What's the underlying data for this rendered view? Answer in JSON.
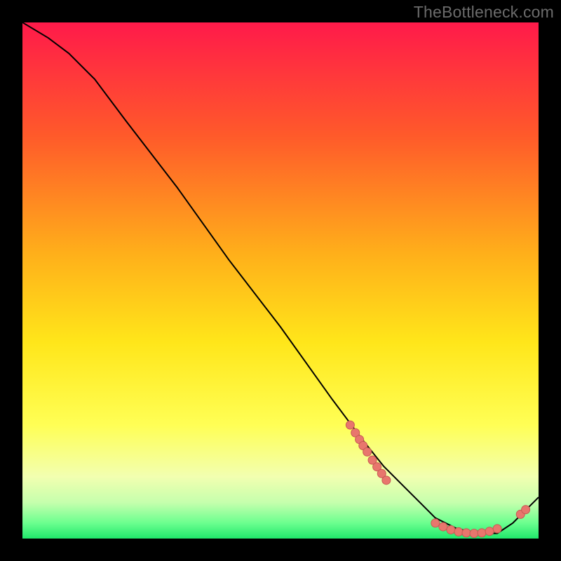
{
  "watermark": "TheBottleneck.com",
  "colors": {
    "page_bg": "#000000",
    "grad_top": "#ff1a4a",
    "grad_upper_mid": "#ff7a1a",
    "grad_mid": "#ffd21a",
    "grad_lower_mid": "#ffff66",
    "grad_pale": "#eaffcc",
    "grad_green": "#2bff7a",
    "line": "#000000",
    "dot_fill": "#e8766d",
    "dot_stroke": "#c75a53"
  },
  "chart_data": {
    "type": "line",
    "title": "",
    "xlabel": "",
    "ylabel": "",
    "xlim": [
      0,
      100
    ],
    "ylim": [
      0,
      100
    ],
    "series": [
      {
        "name": "curve",
        "x": [
          0,
          5,
          9,
          14,
          20,
          30,
          40,
          50,
          60,
          66,
          70,
          74,
          77,
          80,
          84,
          88,
          92,
          95,
          98,
          100
        ],
        "y": [
          100,
          97,
          94,
          89,
          81,
          68,
          54,
          41,
          27,
          19,
          14,
          10,
          7,
          4,
          2,
          1,
          1,
          3,
          6,
          8
        ]
      }
    ],
    "dots": [
      {
        "x": 63.5,
        "y": 22.0
      },
      {
        "x": 64.5,
        "y": 20.5
      },
      {
        "x": 65.3,
        "y": 19.2
      },
      {
        "x": 66.0,
        "y": 18.0
      },
      {
        "x": 66.8,
        "y": 16.8
      },
      {
        "x": 67.8,
        "y": 15.2
      },
      {
        "x": 68.7,
        "y": 13.9
      },
      {
        "x": 69.6,
        "y": 12.6
      },
      {
        "x": 70.5,
        "y": 11.3
      },
      {
        "x": 80.0,
        "y": 3.0
      },
      {
        "x": 81.5,
        "y": 2.3
      },
      {
        "x": 83.0,
        "y": 1.7
      },
      {
        "x": 84.5,
        "y": 1.3
      },
      {
        "x": 86.0,
        "y": 1.1
      },
      {
        "x": 87.5,
        "y": 1.0
      },
      {
        "x": 89.0,
        "y": 1.1
      },
      {
        "x": 90.5,
        "y": 1.4
      },
      {
        "x": 92.0,
        "y": 1.9
      },
      {
        "x": 96.5,
        "y": 4.7
      },
      {
        "x": 97.5,
        "y": 5.6
      }
    ],
    "gradient_stops": [
      {
        "offset": 0.0,
        "color": "#ff1a4a"
      },
      {
        "offset": 0.22,
        "color": "#ff5a2a"
      },
      {
        "offset": 0.45,
        "color": "#ffb01a"
      },
      {
        "offset": 0.62,
        "color": "#ffe61a"
      },
      {
        "offset": 0.78,
        "color": "#ffff55"
      },
      {
        "offset": 0.88,
        "color": "#f2ffb0"
      },
      {
        "offset": 0.93,
        "color": "#c6ffad"
      },
      {
        "offset": 0.97,
        "color": "#6bff8f"
      },
      {
        "offset": 1.0,
        "color": "#20e86b"
      }
    ]
  }
}
